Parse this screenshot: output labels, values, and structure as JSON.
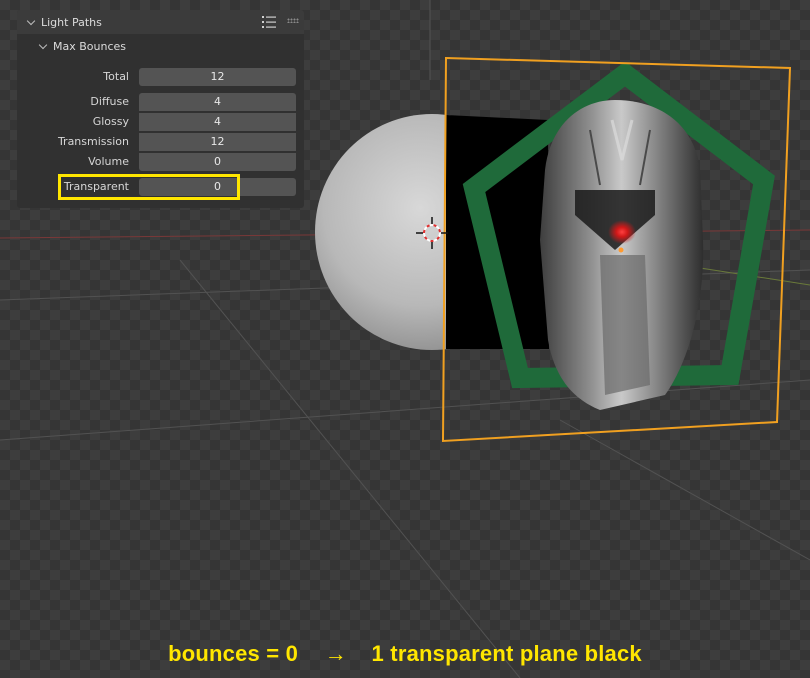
{
  "panel": {
    "section_title": "Light Paths",
    "subsection_title": "Max Bounces",
    "rows": [
      {
        "label": "Total",
        "value": "12"
      },
      {
        "label": "Diffuse",
        "value": "4"
      },
      {
        "label": "Glossy",
        "value": "4"
      },
      {
        "label": "Transmission",
        "value": "12"
      },
      {
        "label": "Volume",
        "value": "0"
      },
      {
        "label": "Transparent",
        "value": "0"
      }
    ]
  },
  "caption": {
    "left": "bounces = 0",
    "arrow": "→",
    "right": "1 transparent plane black"
  },
  "colors": {
    "highlight": "#ffe600",
    "selection_outline": "#f0a020",
    "logo_green": "#1f6a3a",
    "eye_red": "#e02020"
  }
}
